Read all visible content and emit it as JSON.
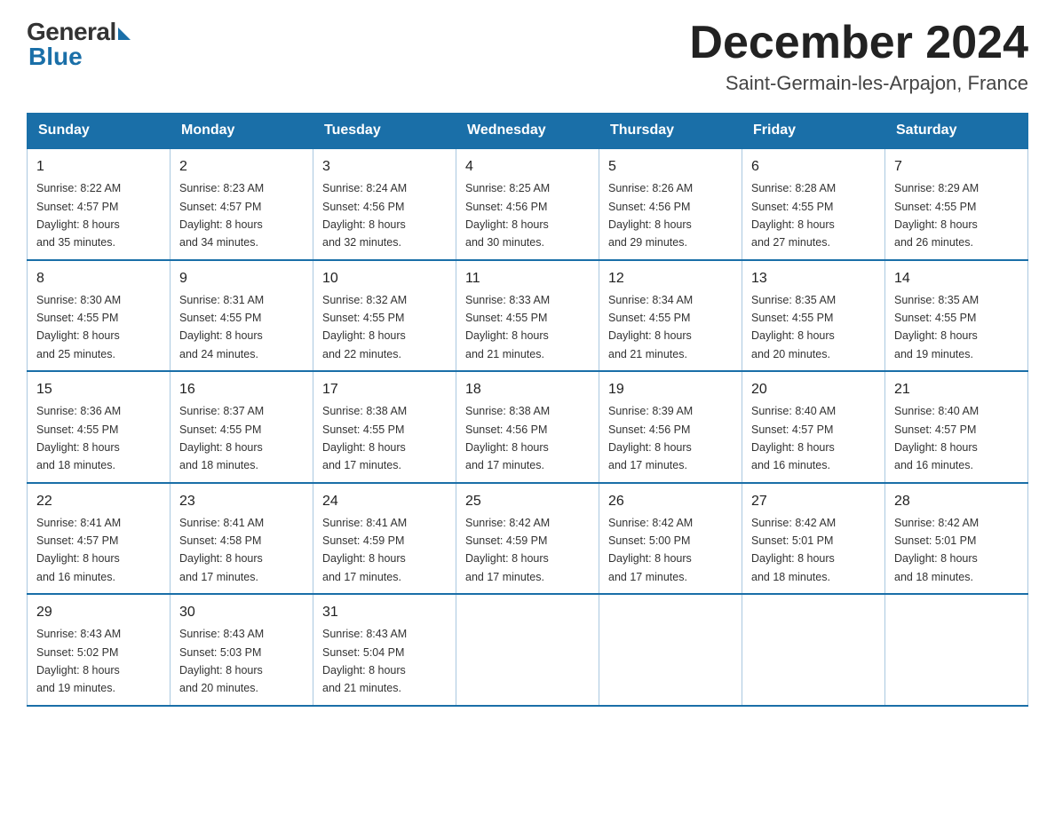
{
  "header": {
    "logo_general": "General",
    "logo_blue": "Blue",
    "month_title": "December 2024",
    "location": "Saint-Germain-les-Arpajon, France"
  },
  "weekdays": [
    "Sunday",
    "Monday",
    "Tuesday",
    "Wednesday",
    "Thursday",
    "Friday",
    "Saturday"
  ],
  "weeks": [
    [
      {
        "day": "1",
        "sunrise": "8:22 AM",
        "sunset": "4:57 PM",
        "daylight": "8 hours and 35 minutes."
      },
      {
        "day": "2",
        "sunrise": "8:23 AM",
        "sunset": "4:57 PM",
        "daylight": "8 hours and 34 minutes."
      },
      {
        "day": "3",
        "sunrise": "8:24 AM",
        "sunset": "4:56 PM",
        "daylight": "8 hours and 32 minutes."
      },
      {
        "day": "4",
        "sunrise": "8:25 AM",
        "sunset": "4:56 PM",
        "daylight": "8 hours and 30 minutes."
      },
      {
        "day": "5",
        "sunrise": "8:26 AM",
        "sunset": "4:56 PM",
        "daylight": "8 hours and 29 minutes."
      },
      {
        "day": "6",
        "sunrise": "8:28 AM",
        "sunset": "4:55 PM",
        "daylight": "8 hours and 27 minutes."
      },
      {
        "day": "7",
        "sunrise": "8:29 AM",
        "sunset": "4:55 PM",
        "daylight": "8 hours and 26 minutes."
      }
    ],
    [
      {
        "day": "8",
        "sunrise": "8:30 AM",
        "sunset": "4:55 PM",
        "daylight": "8 hours and 25 minutes."
      },
      {
        "day": "9",
        "sunrise": "8:31 AM",
        "sunset": "4:55 PM",
        "daylight": "8 hours and 24 minutes."
      },
      {
        "day": "10",
        "sunrise": "8:32 AM",
        "sunset": "4:55 PM",
        "daylight": "8 hours and 22 minutes."
      },
      {
        "day": "11",
        "sunrise": "8:33 AM",
        "sunset": "4:55 PM",
        "daylight": "8 hours and 21 minutes."
      },
      {
        "day": "12",
        "sunrise": "8:34 AM",
        "sunset": "4:55 PM",
        "daylight": "8 hours and 21 minutes."
      },
      {
        "day": "13",
        "sunrise": "8:35 AM",
        "sunset": "4:55 PM",
        "daylight": "8 hours and 20 minutes."
      },
      {
        "day": "14",
        "sunrise": "8:35 AM",
        "sunset": "4:55 PM",
        "daylight": "8 hours and 19 minutes."
      }
    ],
    [
      {
        "day": "15",
        "sunrise": "8:36 AM",
        "sunset": "4:55 PM",
        "daylight": "8 hours and 18 minutes."
      },
      {
        "day": "16",
        "sunrise": "8:37 AM",
        "sunset": "4:55 PM",
        "daylight": "8 hours and 18 minutes."
      },
      {
        "day": "17",
        "sunrise": "8:38 AM",
        "sunset": "4:55 PM",
        "daylight": "8 hours and 17 minutes."
      },
      {
        "day": "18",
        "sunrise": "8:38 AM",
        "sunset": "4:56 PM",
        "daylight": "8 hours and 17 minutes."
      },
      {
        "day": "19",
        "sunrise": "8:39 AM",
        "sunset": "4:56 PM",
        "daylight": "8 hours and 17 minutes."
      },
      {
        "day": "20",
        "sunrise": "8:40 AM",
        "sunset": "4:57 PM",
        "daylight": "8 hours and 16 minutes."
      },
      {
        "day": "21",
        "sunrise": "8:40 AM",
        "sunset": "4:57 PM",
        "daylight": "8 hours and 16 minutes."
      }
    ],
    [
      {
        "day": "22",
        "sunrise": "8:41 AM",
        "sunset": "4:57 PM",
        "daylight": "8 hours and 16 minutes."
      },
      {
        "day": "23",
        "sunrise": "8:41 AM",
        "sunset": "4:58 PM",
        "daylight": "8 hours and 17 minutes."
      },
      {
        "day": "24",
        "sunrise": "8:41 AM",
        "sunset": "4:59 PM",
        "daylight": "8 hours and 17 minutes."
      },
      {
        "day": "25",
        "sunrise": "8:42 AM",
        "sunset": "4:59 PM",
        "daylight": "8 hours and 17 minutes."
      },
      {
        "day": "26",
        "sunrise": "8:42 AM",
        "sunset": "5:00 PM",
        "daylight": "8 hours and 17 minutes."
      },
      {
        "day": "27",
        "sunrise": "8:42 AM",
        "sunset": "5:01 PM",
        "daylight": "8 hours and 18 minutes."
      },
      {
        "day": "28",
        "sunrise": "8:42 AM",
        "sunset": "5:01 PM",
        "daylight": "8 hours and 18 minutes."
      }
    ],
    [
      {
        "day": "29",
        "sunrise": "8:43 AM",
        "sunset": "5:02 PM",
        "daylight": "8 hours and 19 minutes."
      },
      {
        "day": "30",
        "sunrise": "8:43 AM",
        "sunset": "5:03 PM",
        "daylight": "8 hours and 20 minutes."
      },
      {
        "day": "31",
        "sunrise": "8:43 AM",
        "sunset": "5:04 PM",
        "daylight": "8 hours and 21 minutes."
      },
      null,
      null,
      null,
      null
    ]
  ],
  "labels": {
    "sunrise": "Sunrise:",
    "sunset": "Sunset:",
    "daylight": "Daylight:"
  }
}
